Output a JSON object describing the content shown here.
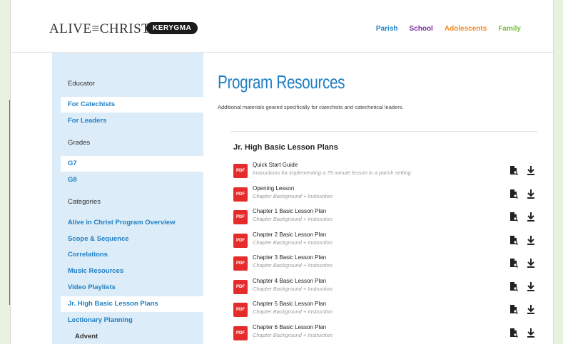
{
  "header": {
    "logo": "ALIVE≡CHRIST",
    "logo_badge": "KERYGMA",
    "nav": [
      {
        "label": "Parish",
        "color": "#1f7fc4"
      },
      {
        "label": "School",
        "color": "#7b2fa0"
      },
      {
        "label": "Adolescents",
        "color": "#f08a24"
      },
      {
        "label": "Family",
        "color": "#7cbf3a"
      }
    ]
  },
  "sidebar": {
    "educator_heading": "Educator",
    "educator_links": [
      "For Catechists",
      "For Leaders"
    ],
    "grades_heading": "Grades",
    "grade_links": [
      "G7",
      "G8"
    ],
    "categories_heading": "Categories",
    "category_links": [
      "Alive in Christ Program Overview",
      "Scope & Sequence",
      "Correlations",
      "Music Resources",
      "Video Playlists",
      "Jr. High Basic Lesson Plans",
      "Lectionary Planning"
    ],
    "sub_item": "Advent"
  },
  "main": {
    "title": "Program Resources",
    "subtitle": "Additional materials geared specifically for catechists and catechetical leaders.",
    "section_title": "Jr. High Basic Lesson Plans",
    "pdf_label": "PDF",
    "resources": [
      {
        "title": "Quick Start Guide",
        "desc": "Instructions for implementing a 75 minute lesson in a parish setting"
      },
      {
        "title": "Opening Lesson",
        "desc": "Chapter Background + Instruction"
      },
      {
        "title": "Chapter 1 Basic Lesson Plan",
        "desc": "Chapter Background + Instruction"
      },
      {
        "title": "Chapter 2 Basic Lesson Plan",
        "desc": "Chapter Background + Instruction"
      },
      {
        "title": "Chapter 3 Basic Lesson Plan",
        "desc": "Chapter Background + Instruction"
      },
      {
        "title": "Chapter 4 Basic Lesson Plan",
        "desc": "Chapter Background + Instruction"
      },
      {
        "title": "Chapter 5 Basic Lesson Plan",
        "desc": "Chapter Background + Instruction"
      },
      {
        "title": "Chapter 6 Basic Lesson Plan",
        "desc": "Chapter Background + Instruction"
      }
    ]
  },
  "colors": {
    "accent": "#1f7fc4",
    "callout": "#7b4a9c",
    "pdf_red": "#e62b2b",
    "sidebar_bg": "#dcecf8",
    "page_bg": "#e9f2df"
  }
}
